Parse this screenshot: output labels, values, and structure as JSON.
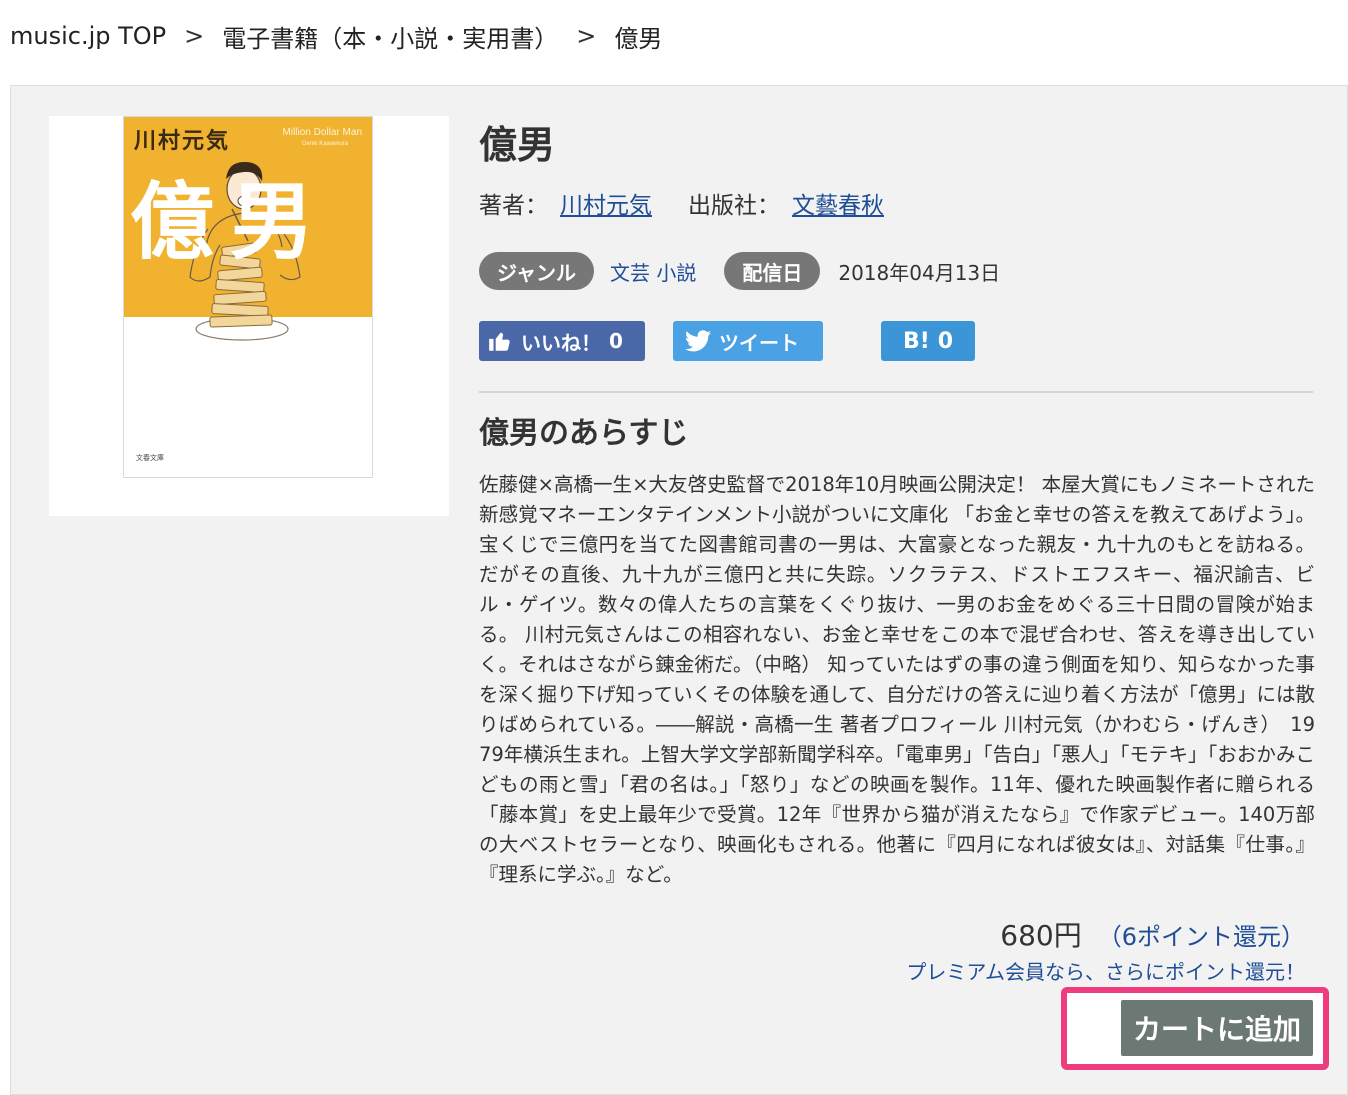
{
  "breadcrumb": {
    "items": [
      "music.jp TOP",
      "電子書籍（本・小説・実用書）",
      "億男"
    ],
    "separator": ">"
  },
  "book": {
    "title": "億男",
    "author_label": "著者：",
    "author": "川村元気",
    "publisher_label": "出版社：",
    "publisher": "文藝春秋",
    "genre_label": "ジャンル",
    "genre": "文芸 小説",
    "release_label": "配信日",
    "release_date": "2018年04月13日"
  },
  "cover": {
    "author": "川村元気",
    "subtitle": "Million Dollar Man",
    "subtitle_author": "Genki Kawamura",
    "title": "億男",
    "publisher_mark": "文春文庫",
    "background_color": "#f0b22f"
  },
  "social": {
    "like_label": "いいね！",
    "like_count": "0",
    "tweet_label": "ツイート",
    "hatena_label": "B!",
    "hatena_count": "0",
    "colors": {
      "facebook": "#4a67a8",
      "twitter": "#4aa1e3",
      "hatena": "#3b95d6"
    }
  },
  "synopsis": {
    "heading": "億男のあらすじ",
    "text": "佐藤健×高橋一生×大友啓史監督で2018年10月映画公開決定！ 本屋大賞にもノミネートされた新感覚マネーエンタテインメント小説がついに文庫化 「お金と幸せの答えを教えてあげよう」。宝くじで三億円を当てた図書館司書の一男は、大富豪となった親友・九十九のもとを訪ねる。だがその直後、九十九が三億円と共に失踪。ソクラテス、ドストエフスキー、福沢諭吉、ビル・ゲイツ。数々の偉人たちの言葉をくぐり抜け、一男のお金をめぐる三十日間の冒険が始まる。 川村元気さんはこの相容れない、お金と幸せをこの本で混ぜ合わせ、答えを導き出していく。それはさながら錬金術だ。（中略） 知っていたはずの事の違う側面を知り、知らなかった事を深く掘り下げ知っていくその体験を通して、自分だけの答えに辿り着く方法が「億男」には散りばめられている。――解説・高橋一生 著者プロフィール 川村元気（かわむら・げんき）　1979年横浜生まれ。上智大学文学部新聞学科卒。「電車男」「告白」「悪人」「モテキ」「おおかみこどもの雨と雪」「君の名は。」「怒り」などの映画を製作。11年、優れた映画製作者に贈られる「藤本賞」を史上最年少で受賞。12年『世界から猫が消えたなら』で作家デビュー。140万部の大ベストセラーとなり、映画化もされる。他著に『四月になれば彼女は』、対話集『仕事。』『理系に学ぶ。』など。"
  },
  "purchase": {
    "price": "680円",
    "points": "（6ポイント還元）",
    "premium_note": "プレミアム会員なら、さらにポイント還元！",
    "cart_label": "カートに追加",
    "highlight_color": "#ef3b7f"
  }
}
